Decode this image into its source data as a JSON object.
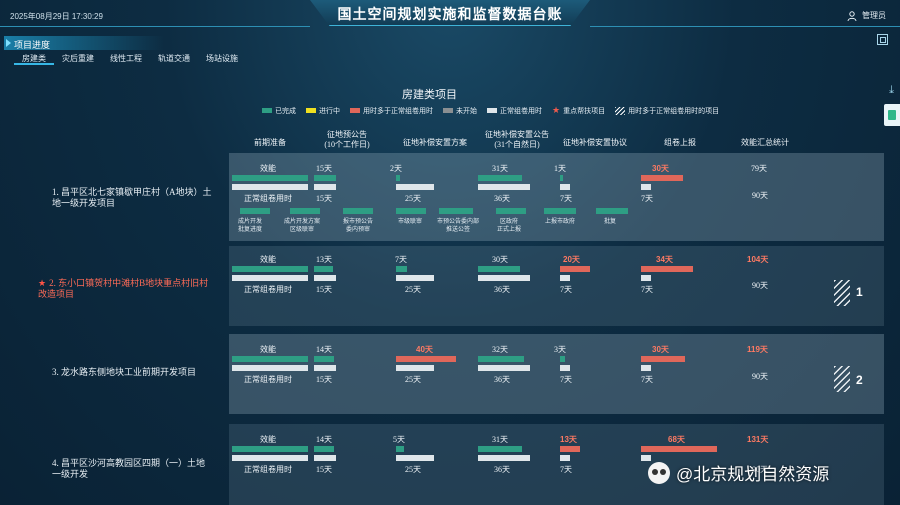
{
  "header": {
    "datetime": "2025年08月29日 17:30:29",
    "title": "国土空间规划实施和监督数据台账",
    "user_label": "管理员"
  },
  "section": {
    "title": "项目进度"
  },
  "tabs": [
    "房建类",
    "灾后重建",
    "线性工程",
    "轨道交通",
    "场站设施"
  ],
  "board_title": "房建类项目",
  "legend": [
    {
      "label": "已完成",
      "color": "#2e9e84"
    },
    {
      "label": "进行中",
      "color": "#f0e020"
    },
    {
      "label": "用时多于正常组卷用时",
      "color": "#e0675a"
    },
    {
      "label": "未开始",
      "color": "#8a8f92"
    },
    {
      "label": "正常组卷用时",
      "color": "#dfe6ea"
    },
    {
      "label": "重点帮扶项目",
      "icon": "star-icon"
    },
    {
      "label": "用时多于正常组卷用时的项目",
      "icon": "hatch-icon"
    }
  ],
  "columns": [
    "前期准备",
    "征地预公告\n(10个工作日)",
    "征地补偿安置方案",
    "征地补偿安置公告\n(31个自然日)",
    "征地补偿安置协议",
    "组卷上报",
    "效能汇总统计"
  ],
  "bar_labels": {
    "actual": "效能",
    "normal": "正常组卷用时"
  },
  "rows": [
    {
      "num": "1.",
      "name": "昌平区北七家镇歇甲庄村（A地块）土地一级开发项目",
      "key": false,
      "stages": [
        {
          "actual": "15天",
          "normal": "15天"
        },
        {
          "actual": "2天",
          "normal": "25天"
        },
        {
          "actual": "31天",
          "normal": "36天"
        },
        {
          "actual": "1天",
          "normal": "7天"
        },
        {
          "actual": "30天",
          "normal": "7天",
          "over": true
        }
      ],
      "total_actual": "79天",
      "total_normal": "90天",
      "substeps": [
        "成片开发\n批复进度",
        "成片开发方案\n区级联审",
        "报市预公告\n委内预审",
        "市级联审",
        "市预公告委内部\n推送公签",
        "区政府\n正式上报",
        "上报市政府",
        "批复"
      ]
    },
    {
      "num": "2.",
      "name": "东小口镇贺村中滩村B地块重点村旧村改造项目",
      "key": true,
      "stages": [
        {
          "actual": "13天",
          "normal": "15天"
        },
        {
          "actual": "7天",
          "normal": "25天"
        },
        {
          "actual": "30天",
          "normal": "36天"
        },
        {
          "actual": "20天",
          "normal": "7天",
          "over": true
        },
        {
          "actual": "34天",
          "normal": "7天",
          "over": true
        }
      ],
      "total_actual": "104天",
      "total_normal": "90天",
      "over_count": "1"
    },
    {
      "num": "3.",
      "name": "龙水路东侧地块工业前期开发项目",
      "key": false,
      "stages": [
        {
          "actual": "14天",
          "normal": "15天"
        },
        {
          "actual": "40天",
          "normal": "25天",
          "over": true
        },
        {
          "actual": "32天",
          "normal": "36天"
        },
        {
          "actual": "3天",
          "normal": "7天"
        },
        {
          "actual": "30天",
          "normal": "7天",
          "over": true
        }
      ],
      "total_actual": "119天",
      "total_normal": "90天",
      "over_count": "2"
    },
    {
      "num": "4.",
      "name": "昌平区沙河高教园区四期（一）土地一级开发",
      "key": false,
      "stages": [
        {
          "actual": "14天",
          "normal": "15天"
        },
        {
          "actual": "5天",
          "normal": "25天"
        },
        {
          "actual": "31天",
          "normal": "36天"
        },
        {
          "actual": "13天",
          "normal": "7天",
          "over": true
        },
        {
          "actual": "68天",
          "normal": "7天",
          "over": true
        }
      ],
      "total_actual": "131天",
      "total_normal": "90天"
    }
  ],
  "watermark": "@北京规划自然资源"
}
